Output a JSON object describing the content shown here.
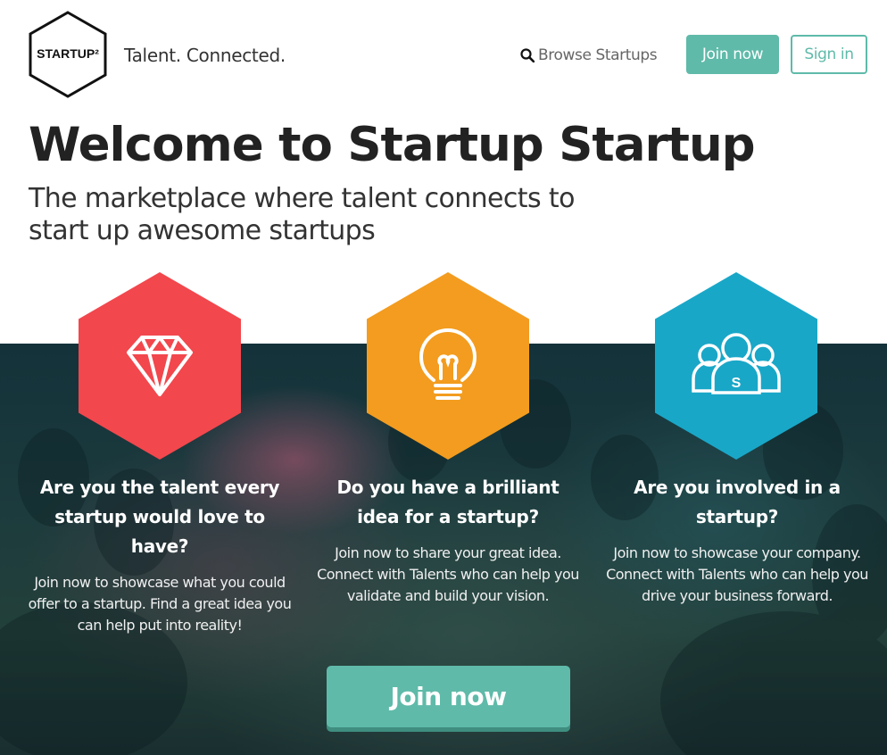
{
  "header": {
    "logo_text": "STARTUP²",
    "tagline": "Talent. Connected.",
    "browse_label": "Browse Startups",
    "join_label": "Join now",
    "signin_label": "Sign in"
  },
  "hero": {
    "title": "Welcome to Startup Startup",
    "subtitle": "The marketplace where talent connects to start up awesome startups"
  },
  "features": [
    {
      "icon": "diamond-icon",
      "color": "#f2474d",
      "heading": "Are you the talent every startup would love to have?",
      "text": "Join now to showcase what you could offer to a startup. Find a great idea you can help put into reality!"
    },
    {
      "icon": "lightbulb-icon",
      "color": "#f39c1f",
      "heading": "Do you have a brilliant idea for a startup?",
      "text": "Join now to share your great idea. Connect with Talents who can help you validate and build your vision."
    },
    {
      "icon": "team-icon",
      "color": "#19a7c8",
      "heading": "Are you involved in a startup?",
      "text": "Join now to showcase your company. Connect with Talents who can help you drive your business forward."
    }
  ],
  "cta": {
    "join_label": "Join now"
  },
  "colors": {
    "accent": "#5fbaa9",
    "red": "#f2474d",
    "orange": "#f39c1f",
    "blue": "#19a7c8"
  }
}
